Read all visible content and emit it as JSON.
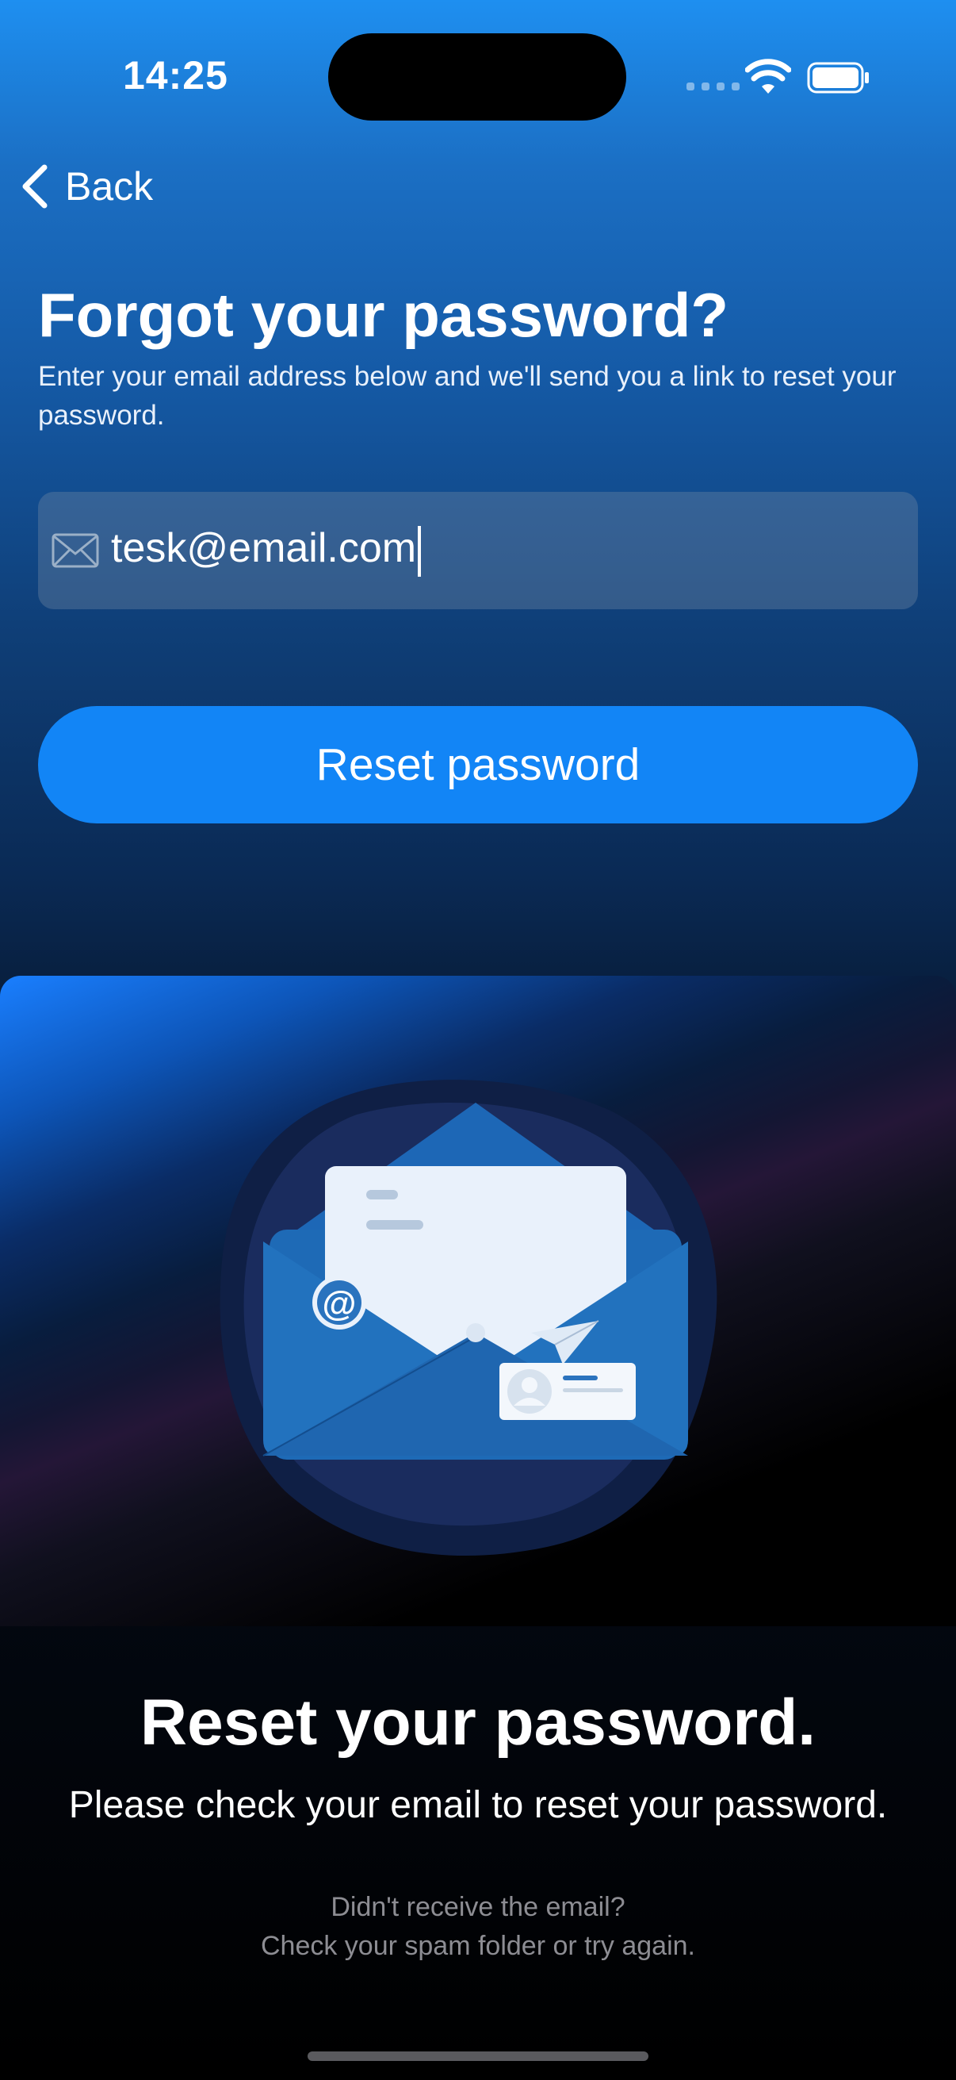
{
  "status_bar": {
    "time": "14:25"
  },
  "nav": {
    "back_label": "Back"
  },
  "header": {
    "title": "Forgot your password?",
    "subtitle": "Enter your email address below and we'll send you a link to reset your password."
  },
  "email_input": {
    "value": "tesk@email.com",
    "icon": "envelope-icon"
  },
  "reset_button": {
    "label": "Reset password"
  },
  "illustration": {
    "badge_symbol": "@"
  },
  "confirmation": {
    "title": "Reset your password.",
    "message": "Please check your email to reset your password.",
    "hint_line1": "Didn't receive the email?",
    "hint_line2": "Check your spam folder or try again."
  },
  "colors": {
    "accent": "#1285f6",
    "field_bg": "#4a6585",
    "hint": "#8d8d93"
  }
}
